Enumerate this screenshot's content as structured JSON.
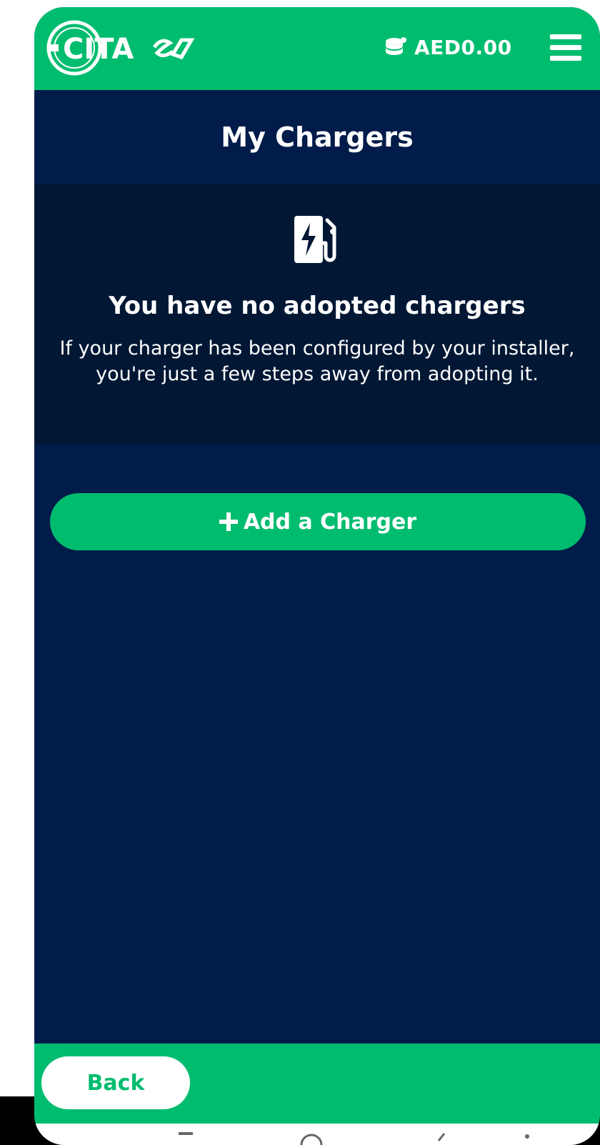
{
  "header": {
    "brand_name": "CITA ev",
    "balance": "AED0.00",
    "icons": [
      "coins-icon",
      "hamburger-menu-icon"
    ]
  },
  "page": {
    "title": "My Chargers"
  },
  "empty_state": {
    "icon": "ev-charger-icon",
    "title": "You have no adopted chargers",
    "description": "If your charger has been configured by your installer, you're just a few steps away from adopting it."
  },
  "actions": {
    "add_charger_label": "Add a Charger",
    "back_label": "Back"
  },
  "colors": {
    "brand_green": "#00bc6f",
    "navy": "#011c4a",
    "panel_dark": "#011734",
    "white": "#ffffff"
  }
}
